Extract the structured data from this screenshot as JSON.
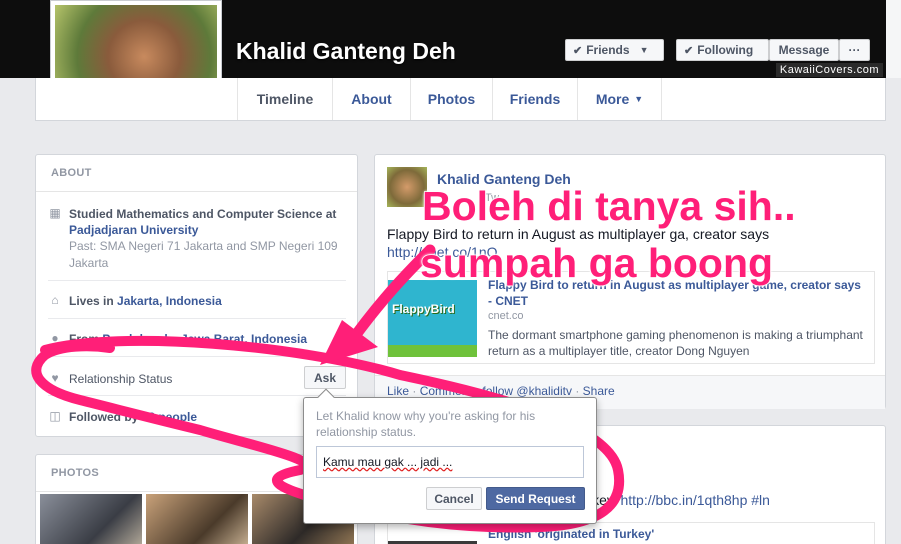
{
  "profile": {
    "name": "Khalid Ganteng Deh",
    "watermark": "KawaiiCovers.com",
    "buttons": {
      "friends": "Friends",
      "following": "Following",
      "message": "Message",
      "more": "···"
    }
  },
  "nav": {
    "tabs": [
      {
        "label": "Timeline"
      },
      {
        "label": "About"
      },
      {
        "label": "Photos"
      },
      {
        "label": "Friends"
      },
      {
        "label": "More"
      }
    ]
  },
  "about": {
    "header": "ABOUT",
    "education": {
      "line1_prefix": "Studied Mathematics and Computer Science at",
      "school": "Padjadjaran University",
      "past": "Past: SMA Negeri 71 Jakarta and SMP Negeri 109 Jakarta"
    },
    "lives": {
      "prefix": "Lives in ",
      "place": "Jakarta, Indonesia"
    },
    "from": {
      "prefix": "From ",
      "place": "Pondokgede, Jawa Barat, Indonesia"
    },
    "relationship": {
      "label": "Relationship Status",
      "ask_label": "Ask"
    },
    "followed": {
      "prefix": "Followed by ",
      "count": "32 people"
    }
  },
  "photos": {
    "header": "PHOTOS"
  },
  "post1": {
    "author": "Khalid Ganteng Deh",
    "meta": "Tw",
    "text": "Flappy Bird to return in August as multiplayer ga, creator says",
    "link": "http://cnet.co/1nO",
    "link_title": "Flappy Bird to return in August as multiplayer game, creator says - CNET",
    "link_host": "cnet.co",
    "link_desc": "The dormant smartphone gaming phenomenon is making a triumphant return as a multiplayer title, creator Dong Nguyen",
    "thumb_title": "FlappyBird",
    "actions": {
      "like": "Like",
      "comment": "Comment",
      "follow": "follow @khaliditv",
      "share": "Share"
    }
  },
  "post2": {
    "text_suffix": "'urkey'",
    "link": "http://bbc.in/1qth8hp #ln",
    "link_title": "English 'originated in Turkey'"
  },
  "popup": {
    "message": "Let Khalid know why you're asking for his relationship status.",
    "input_value": "Kamu mau gak ... jadi ...",
    "cancel_label": "Cancel",
    "send_label": "Send Request"
  },
  "annotation": {
    "line1": "Boleh di tanya sih..",
    "line2": "sumpah ga boong",
    "color": "#ff1f78"
  },
  "colors": {
    "link": "#3b5998",
    "primary_button": "#4e69a2",
    "background": "#e9eaed"
  }
}
